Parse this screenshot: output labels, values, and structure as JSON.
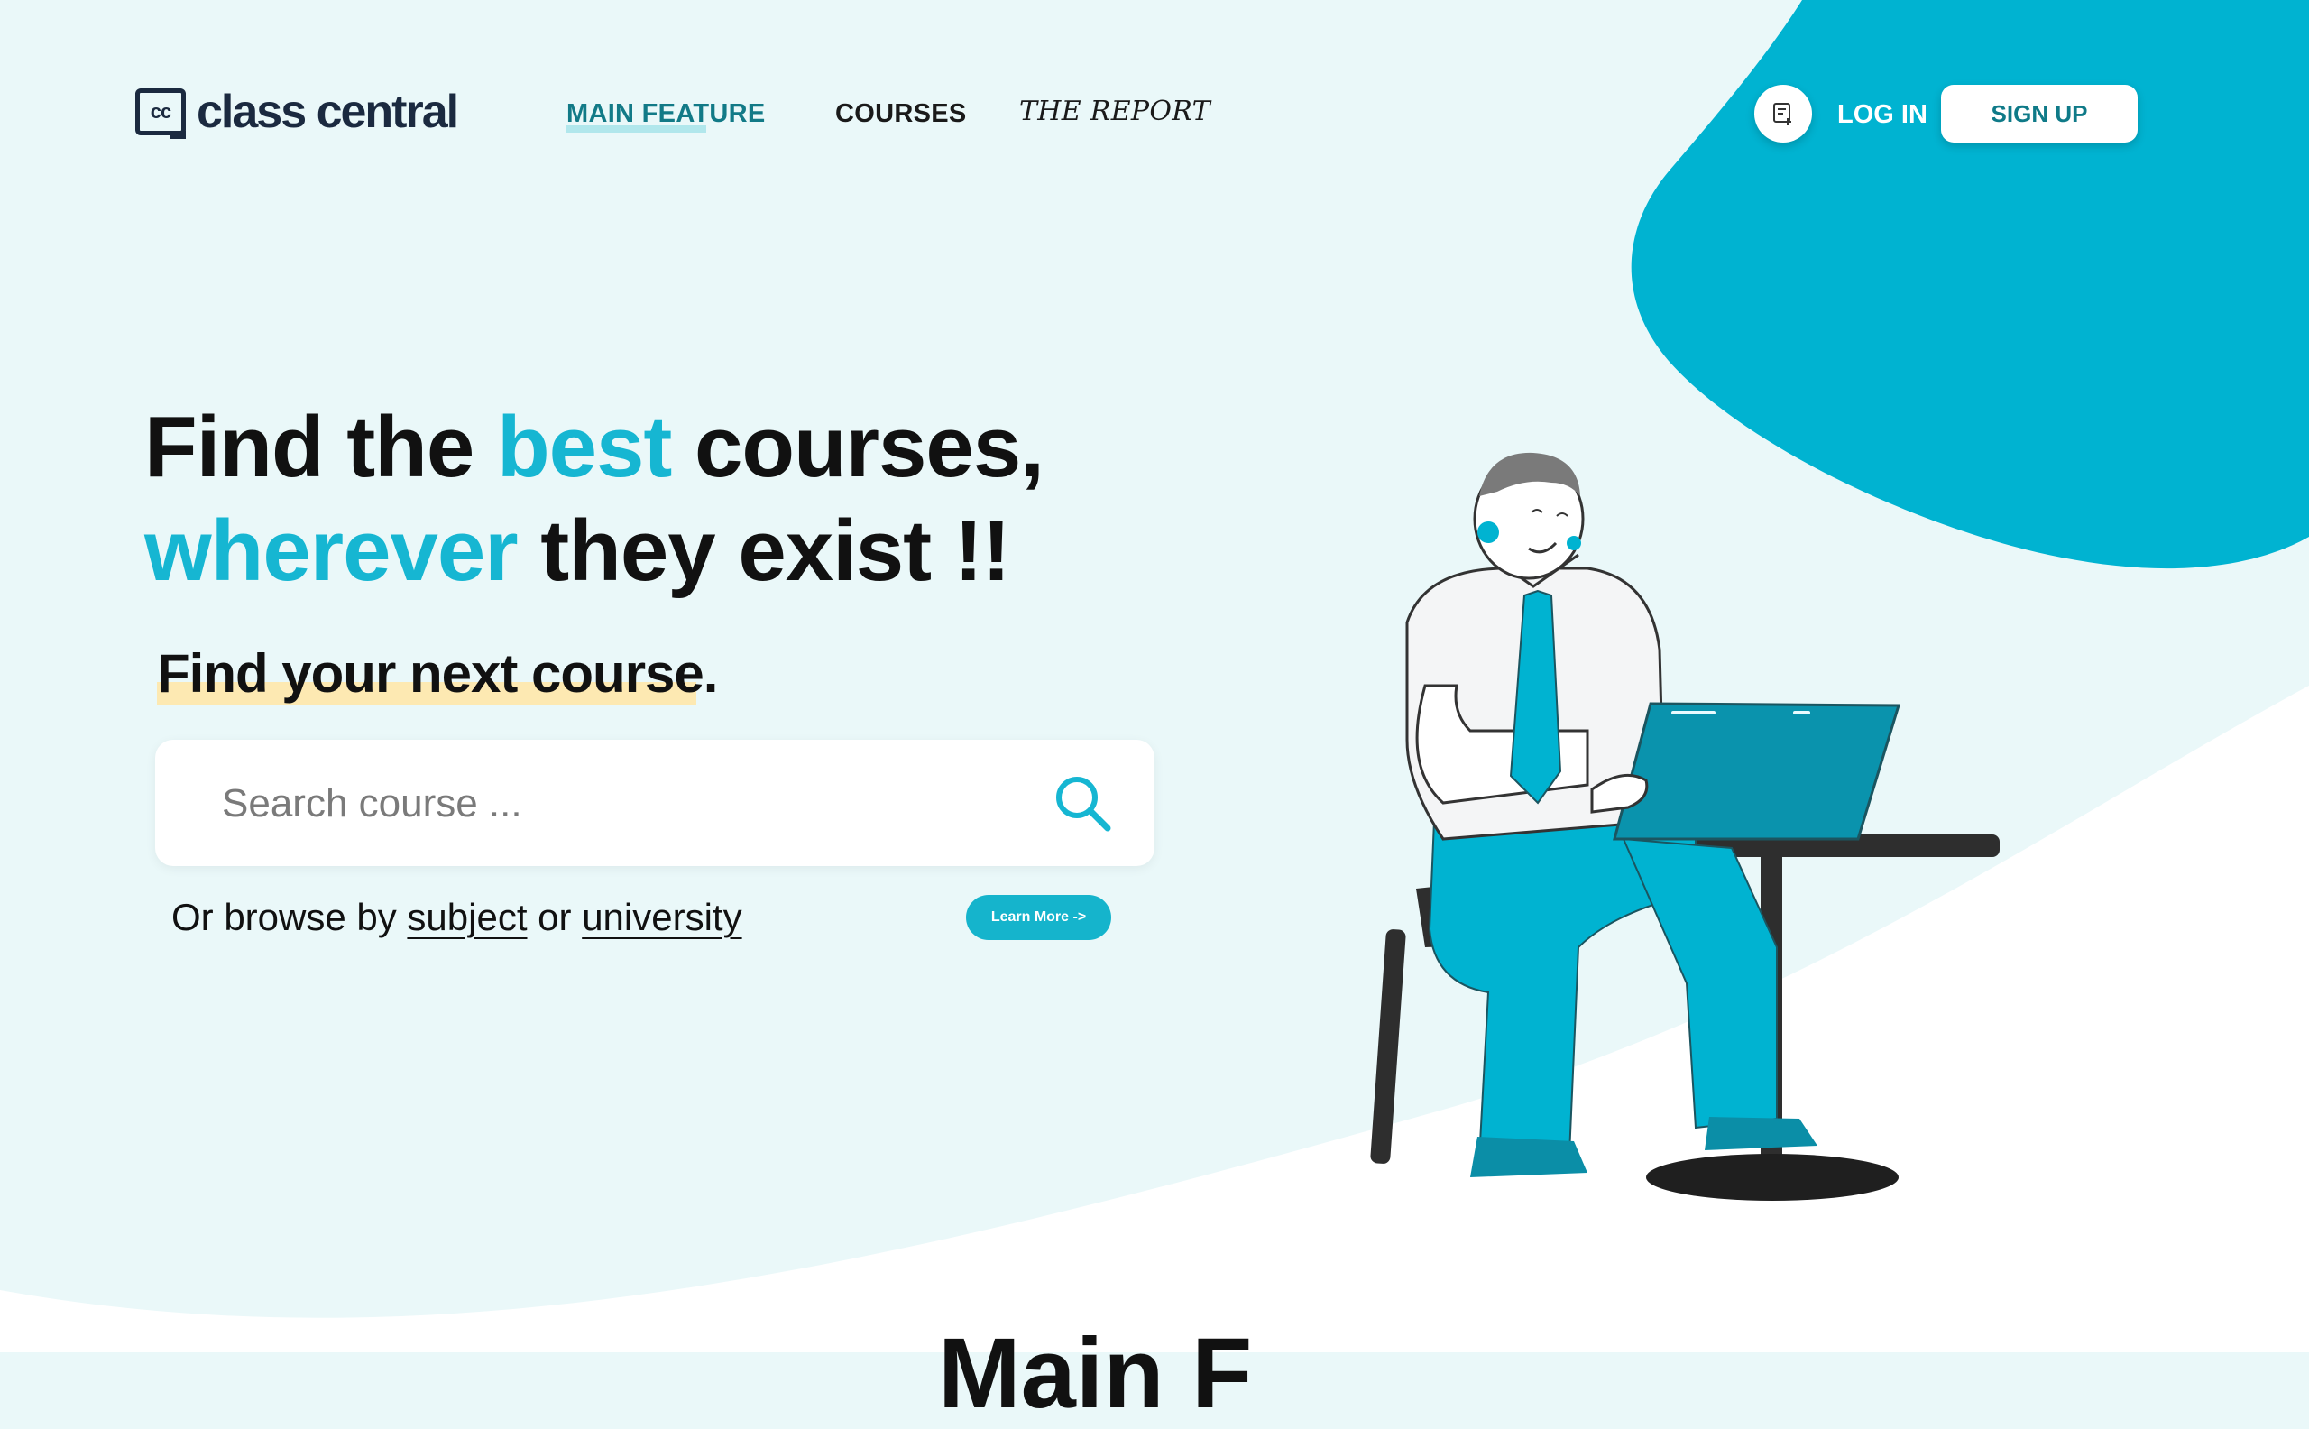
{
  "brand": {
    "logo_mark": "cc",
    "name": "class central"
  },
  "nav": {
    "items": [
      {
        "label": "MAIN FEATURE",
        "active": true
      },
      {
        "label": "COURSES",
        "active": false
      },
      {
        "label": "THE REPORT",
        "active": false
      }
    ]
  },
  "header_actions": {
    "note_icon": "note-add-icon",
    "login_label": "LOG IN",
    "signup_label": "SIGN UP"
  },
  "hero": {
    "line1": {
      "part1": "Find the ",
      "accent": "best",
      "part2": " courses,"
    },
    "line2": {
      "accent": "wherever",
      "part2": " they exist !!"
    },
    "subheading": {
      "text": "Find your next course",
      "suffix": "."
    }
  },
  "search": {
    "placeholder": "Search course ...",
    "value": ""
  },
  "browse": {
    "prefix": "Or browse by ",
    "subject_link": "subject",
    "middle": " or ",
    "university_link": "university"
  },
  "learn_more": {
    "label": "Learn More ->"
  },
  "section_peek": {
    "text": "Main F"
  },
  "colors": {
    "accent": "#16b6d2",
    "blob": "#00b3d1",
    "background": "#eaf8f9",
    "brand_dark": "#1b2a40",
    "highlight": "#fde9b2"
  }
}
